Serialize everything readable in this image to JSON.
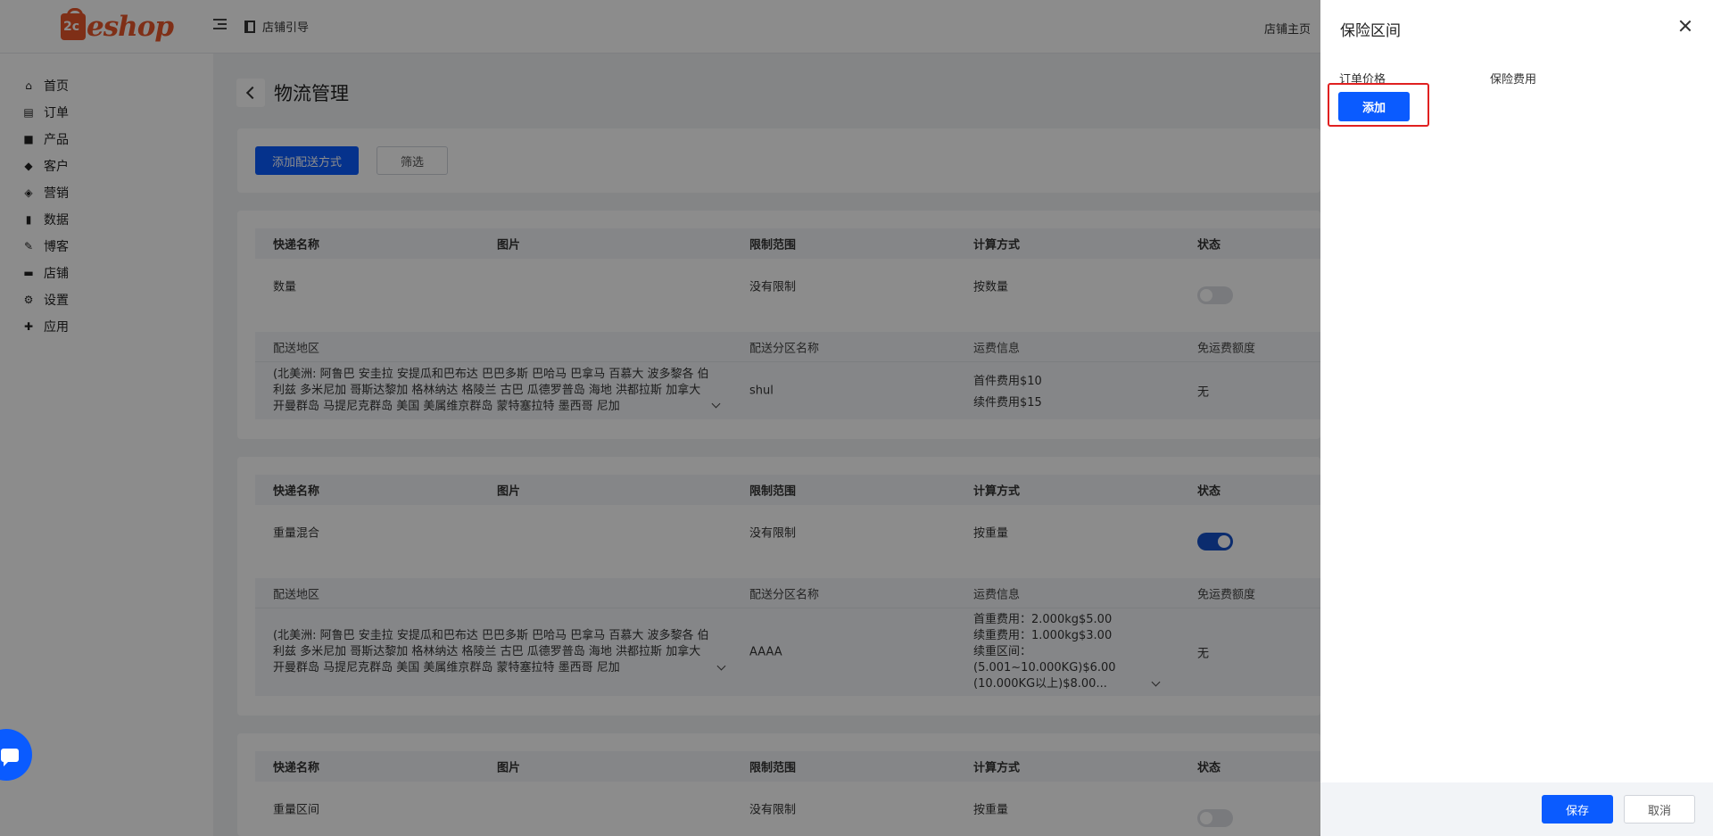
{
  "header": {
    "logo_text": "eshop",
    "guide_label": "店铺引导",
    "store_home": "店铺主页"
  },
  "sidebar": {
    "items": [
      {
        "label": "首页",
        "icon": "home-icon"
      },
      {
        "label": "订单",
        "icon": "order-icon"
      },
      {
        "label": "产品",
        "icon": "product-icon"
      },
      {
        "label": "客户",
        "icon": "customer-icon"
      },
      {
        "label": "营销",
        "icon": "tag-icon"
      },
      {
        "label": "数据",
        "icon": "chart-icon"
      },
      {
        "label": "博客",
        "icon": "edit-icon"
      },
      {
        "label": "店铺",
        "icon": "store-icon"
      },
      {
        "label": "设置",
        "icon": "gear-icon"
      },
      {
        "label": "应用",
        "icon": "puzzle-icon"
      }
    ]
  },
  "page": {
    "title": "物流管理",
    "add_button": "添加配送方式",
    "filter_button": "筛选"
  },
  "table_headers": {
    "name": "快递名称",
    "image": "图片",
    "limit": "限制范围",
    "calc": "计算方式",
    "status": "状态"
  },
  "sub_headers": {
    "region": "配送地区",
    "zone_name": "配送分区名称",
    "fee_info": "运费信息",
    "free_quota": "免运费额度"
  },
  "shipping_methods": [
    {
      "name": "数量",
      "limit": "没有限制",
      "calc": "按数量",
      "enabled": false,
      "region": "(北美洲: 阿鲁巴 安圭拉 安提瓜和巴布达 巴巴多斯 巴哈马 巴拿马 百慕大 波多黎各 伯利兹 多米尼加 哥斯达黎加 格林纳达 格陵兰 古巴 瓜德罗普岛 海地 洪都拉斯 加拿大 开曼群岛 马提尼克群岛 美国 美属维京群岛 蒙特塞拉特 墨西哥 尼加",
      "zone": "shul",
      "fees": [
        "首件费用$10",
        "续件费用$15"
      ],
      "free": "无"
    },
    {
      "name": "重量混合",
      "limit": "没有限制",
      "calc": "按重量",
      "enabled": true,
      "region": "(北美洲: 阿鲁巴 安圭拉 安提瓜和巴布达 巴巴多斯 巴哈马 巴拿马 百慕大 波多黎各 伯利兹 多米尼加 哥斯达黎加 格林纳达 格陵兰 古巴 瓜德罗普岛 海地 洪都拉斯 加拿大 开曼群岛 马提尼克群岛 美国 美属维京群岛 蒙特塞拉特 墨西哥 尼加",
      "zone": "AAAA",
      "fees": [
        "首重费用：2.000kg$5.00",
        "续重费用：1.000kg$3.00",
        "续重区间：",
        "(5.001~10.000KG)$6.00",
        "(10.000KG以上)$8.00..."
      ],
      "free": "无"
    },
    {
      "name": "重量区间",
      "limit": "没有限制",
      "calc": "按重量",
      "enabled": false
    }
  ],
  "drawer": {
    "title": "保险区间",
    "col_order_price": "订单价格",
    "col_insurance_fee": "保险费用",
    "add_button": "添加",
    "save_button": "保存",
    "cancel_button": "取消"
  },
  "colors": {
    "primary": "#0a5bff",
    "brand": "#e8562a",
    "highlight": "#e02020"
  }
}
